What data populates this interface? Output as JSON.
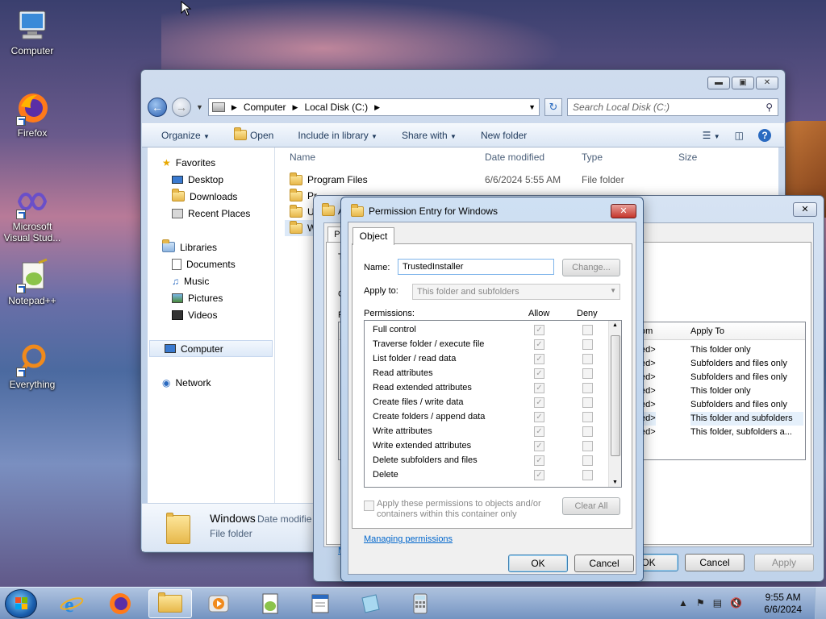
{
  "desktop": {
    "icons": [
      {
        "label": "Computer"
      },
      {
        "label": "Firefox"
      },
      {
        "label": "Microsoft Visual Stud..."
      },
      {
        "label": "Notepad++"
      },
      {
        "label": "Everything"
      }
    ]
  },
  "explorer": {
    "breadcrumb": [
      "Computer",
      "Local Disk (C:)"
    ],
    "search_placeholder": "Search Local Disk (C:)",
    "toolbar": {
      "organize": "Organize",
      "open": "Open",
      "include_in_library": "Include in library",
      "share_with": "Share with",
      "new_folder": "New folder"
    },
    "nav": {
      "favorites": "Favorites",
      "desktop": "Desktop",
      "downloads": "Downloads",
      "recent_places": "Recent Places",
      "libraries": "Libraries",
      "documents": "Documents",
      "music": "Music",
      "pictures": "Pictures",
      "videos": "Videos",
      "computer": "Computer",
      "network": "Network"
    },
    "columns": {
      "name": "Name",
      "date_modified": "Date modified",
      "type": "Type",
      "size": "Size"
    },
    "files": [
      {
        "name": "Program Files",
        "date": "6/6/2024 5:55 AM",
        "type": "File folder"
      },
      {
        "name": "Pr",
        "date": "",
        "type": ""
      },
      {
        "name": "U",
        "date": "",
        "type": ""
      },
      {
        "name": "W",
        "date": "",
        "type": ""
      }
    ],
    "details": {
      "name": "Windows",
      "date_label": "Date modifie",
      "type": "File folder"
    }
  },
  "advanced": {
    "title_fragment": "A",
    "tab_fragment": "Pe",
    "frag_t": "T",
    "frag_c": "C",
    "frag_p": "P",
    "frag_m": "M",
    "columns": {
      "inherited": "om",
      "apply_to": "Apply To"
    },
    "rows": [
      {
        "inherited": "ed>",
        "apply_to": "This folder only"
      },
      {
        "inherited": "ed>",
        "apply_to": "Subfolders and files only"
      },
      {
        "inherited": "ed>",
        "apply_to": "Subfolders and files only"
      },
      {
        "inherited": "ed>",
        "apply_to": "This folder only"
      },
      {
        "inherited": "ed>",
        "apply_to": "Subfolders and files only"
      },
      {
        "inherited": "ed>",
        "apply_to": "This folder and subfolders"
      },
      {
        "inherited": "ed>",
        "apply_to": "This folder, subfolders a..."
      }
    ],
    "ok": "OK",
    "cancel": "Cancel",
    "apply": "Apply"
  },
  "permission_entry": {
    "title": "Permission Entry for Windows",
    "tab": "Object",
    "name_label": "Name:",
    "name_value": "TrustedInstaller",
    "change_button": "Change...",
    "apply_to_label": "Apply to:",
    "apply_to_value": "This folder and subfolders",
    "permissions_label": "Permissions:",
    "allow_header": "Allow",
    "deny_header": "Deny",
    "permissions": [
      "Full control",
      "Traverse folder / execute file",
      "List folder / read data",
      "Read attributes",
      "Read extended attributes",
      "Create files / write data",
      "Create folders / append data",
      "Write attributes",
      "Write extended attributes",
      "Delete subfolders and files",
      "Delete"
    ],
    "apply_checkbox_label": "Apply these permissions to objects and/or containers within this container only",
    "clear_all": "Clear All",
    "managing_link": "Managing permissions",
    "ok": "OK",
    "cancel": "Cancel"
  },
  "taskbar": {
    "time": "9:55 AM",
    "date": "6/6/2024"
  }
}
